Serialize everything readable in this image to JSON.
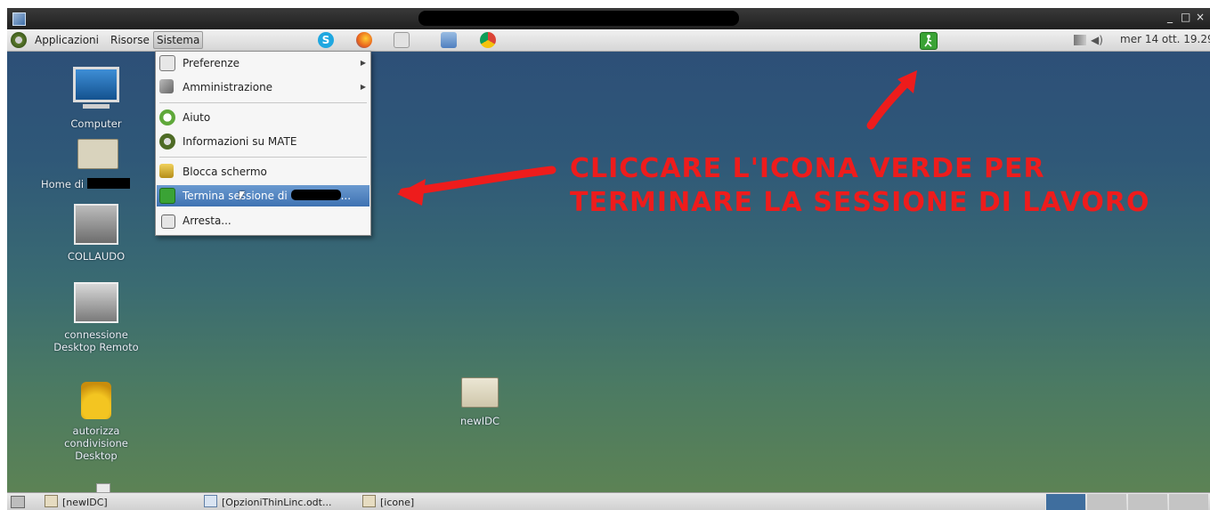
{
  "top_panel": {
    "menus": [
      "Applicazioni",
      "Risorse",
      "Sistema"
    ],
    "clock": "mer 14 ott. 19.29"
  },
  "window_controls": [
    "_",
    "□",
    "×"
  ],
  "desktop_icons": [
    {
      "label_line1": "Computer",
      "label_line2": ""
    },
    {
      "label_line1": "Home di",
      "label_line2": ""
    },
    {
      "label_line1": "COLLAUDO",
      "label_line2": ""
    },
    {
      "label_line1": "connessione",
      "label_line2": "Desktop Remoto"
    },
    {
      "label_line1": "autorizza",
      "label_line2": "condivisione",
      "label_line3": "Desktop"
    },
    {
      "label_line1": "newIDC",
      "label_line2": ""
    }
  ],
  "system_menu": {
    "items": [
      {
        "label": "Preferenze",
        "submenu": true
      },
      {
        "label": "Amministrazione",
        "submenu": true
      },
      {
        "label": "Aiuto",
        "submenu": false
      },
      {
        "label": "Informazioni su MATE",
        "submenu": false
      },
      {
        "label": "Blocca schermo",
        "submenu": false
      },
      {
        "label": "Termina sessione di",
        "suffix": "...",
        "submenu": false,
        "highlighted": true
      },
      {
        "label": "Arresta...",
        "submenu": false
      }
    ]
  },
  "annotation": {
    "line1": "CLICCARE L'ICONA VERDE PER",
    "line2": "TERMINARE LA SESSIONE DI LAVORO",
    "color": "#ee1c1c"
  },
  "taskbar": {
    "tasks": [
      "[newIDC]",
      "[OpzioniThinLinc.odt...",
      "[icone]"
    ]
  },
  "colors": {
    "logout_icon_green": "#3aa335",
    "menu_highlight": "#4a7dbd",
    "annotation_red": "#ee1c1c"
  }
}
